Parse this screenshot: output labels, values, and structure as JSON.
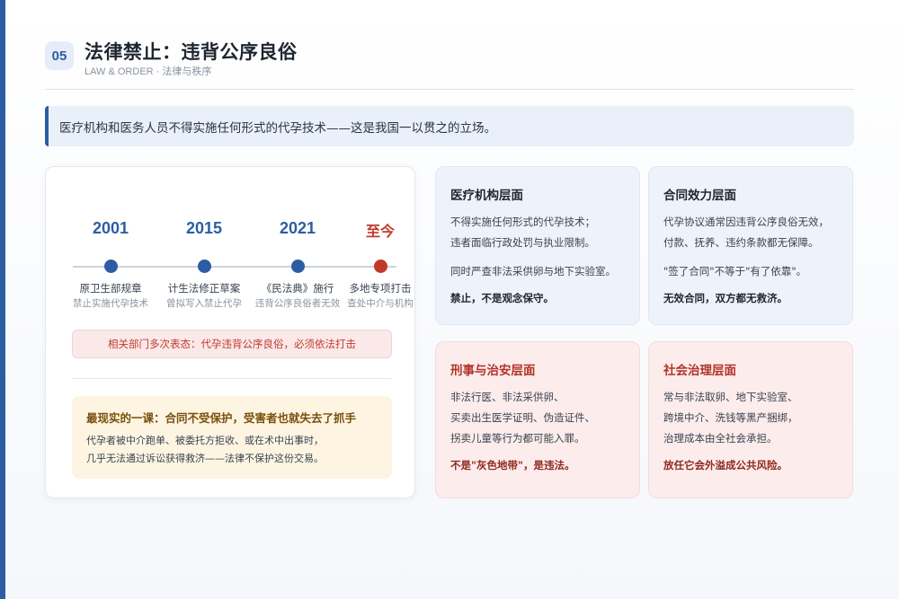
{
  "header": {
    "number": "05",
    "title": "法律禁止：违背公序良俗",
    "subtitle": "LAW & ORDER · 法律与秩序"
  },
  "intro": "医疗机构和医务人员不得实施任何形式的代孕技术——这是我国一以贯之的立场。",
  "timeline": [
    {
      "year": "2001",
      "label": "原卫生部规章",
      "desc": "禁止实施代孕技术"
    },
    {
      "year": "2015",
      "label": "计生法修正草案",
      "desc": "曾拟写入禁止代孕"
    },
    {
      "year": "2021",
      "label": "《民法典》施行",
      "desc": "违背公序良俗者无效"
    },
    {
      "year": "至今",
      "label": "多地专项打击",
      "desc": "查处中介与机构"
    }
  ],
  "warning": "相关部门多次表态：代孕违背公序良俗，必须依法打击",
  "lesson": {
    "title": "最现实的一课：合同不受保护，受害者也就失去了抓手",
    "line1": "代孕者被中介跑单、被委托方拒收、或在术中出事时，",
    "line2": "几乎无法通过诉讼获得救济——法律不保护这份交易。"
  },
  "cards": {
    "medical": {
      "title": "医疗机构层面",
      "line1": "不得实施任何形式的代孕技术；",
      "line2": "违者面临行政处罚与执业限制。",
      "line3": "同时严查非法采供卵与地下实验室。",
      "strong": "禁止，不是观念保守。"
    },
    "contract": {
      "title": "合同效力层面",
      "line1": "代孕协议通常因违背公序良俗无效，",
      "line2": "付款、抚养、违约条款都无保障。",
      "line3": "\"签了合同\"不等于\"有了依靠\"。",
      "strong": "无效合同，双方都无救济。"
    },
    "criminal": {
      "title": "刑事与治安层面",
      "line1": "非法行医、非法采供卵、",
      "line2": "买卖出生医学证明、伪造证件、",
      "line3": "拐卖儿童等行为都可能入罪。",
      "strong": "不是\"灰色地带\"，是违法。"
    },
    "social": {
      "title": "社会治理层面",
      "line1": "常与非法取卵、地下实验室、",
      "line2": "跨境中介、洗钱等黑产捆绑，",
      "line3": "治理成本由全社会承担。",
      "strong": "放任它会外溢成公共风险。"
    }
  },
  "colors": {
    "accent": "#2c5da3",
    "danger": "#c0392b",
    "lesson_bg": "#fdf5e2"
  }
}
